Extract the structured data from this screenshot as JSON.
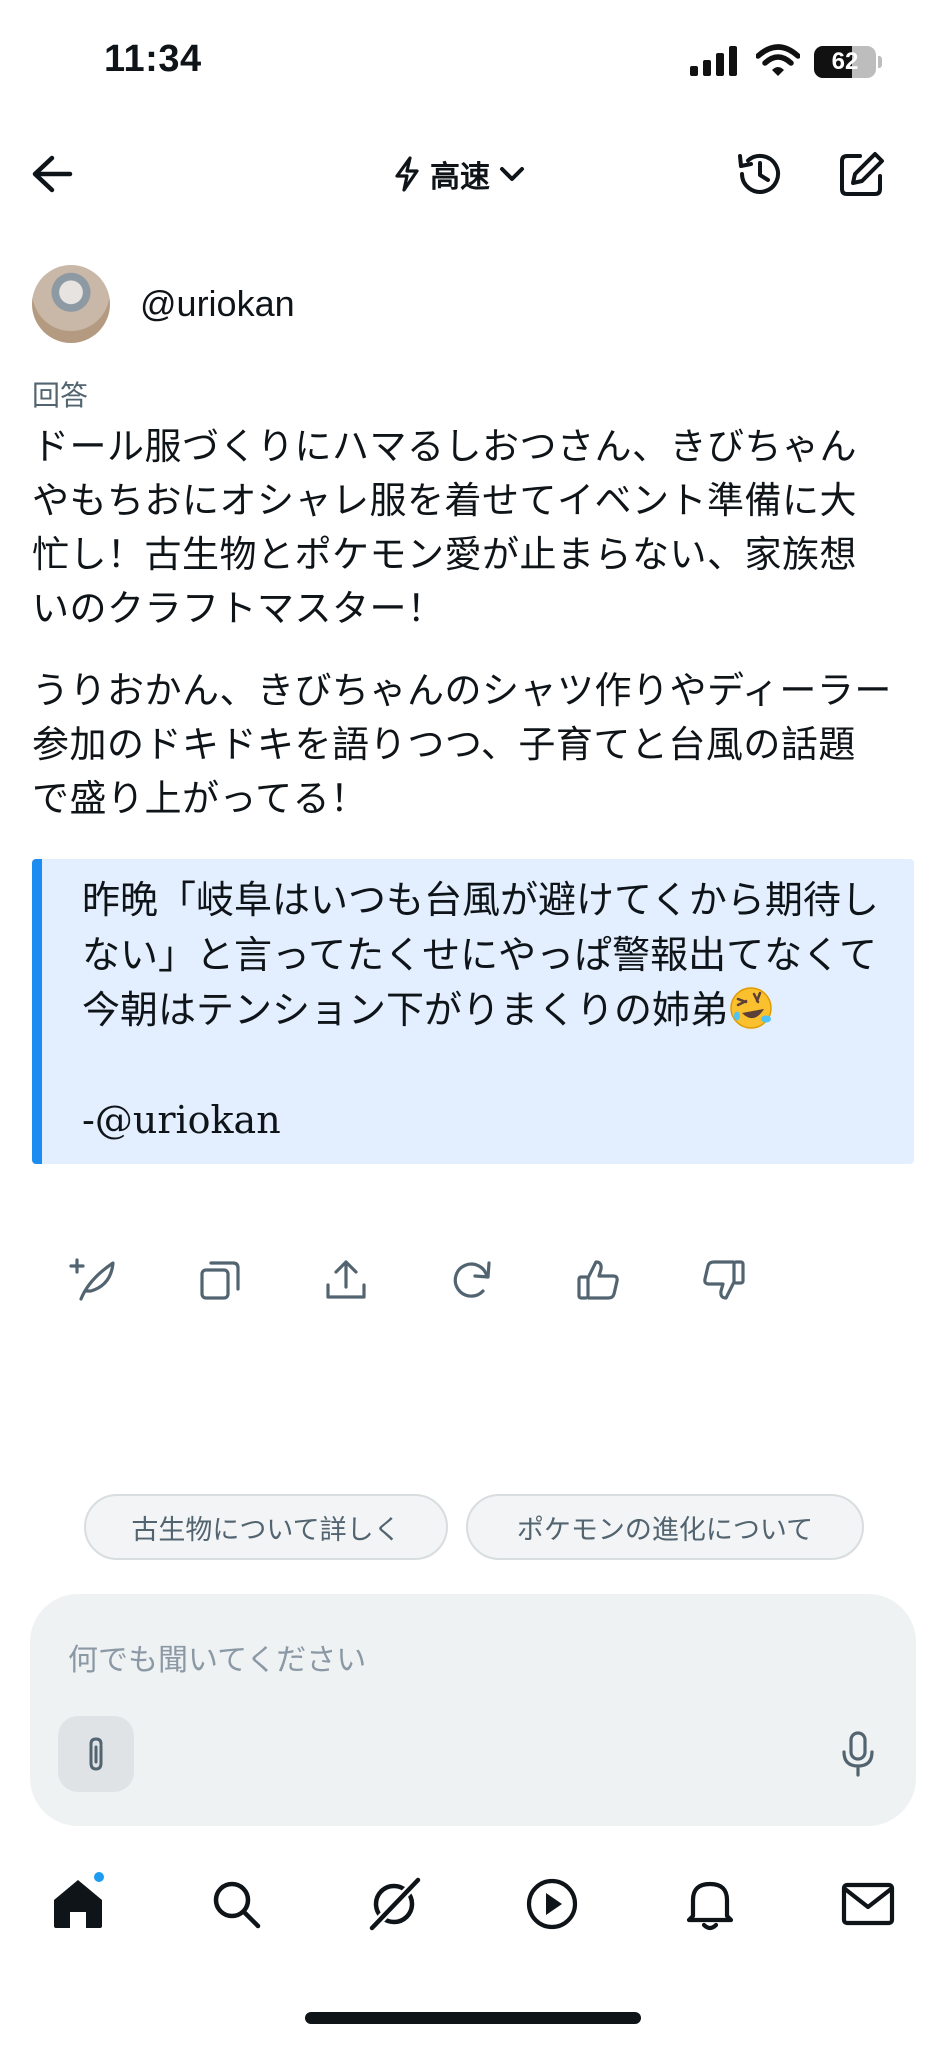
{
  "status_bar": {
    "time": "11:34",
    "battery_level": "62",
    "battery_fraction": 0.62,
    "icons": [
      "signal-icon",
      "wifi-icon",
      "battery-icon"
    ]
  },
  "header": {
    "mode_label": "高速",
    "icons": [
      "back-arrow-icon",
      "lightning-icon",
      "chevron-down-icon",
      "history-icon",
      "new-chat-icon"
    ]
  },
  "post": {
    "username": "@uriokan",
    "label": "回答",
    "paragraphs": [
      "ドール服づくりにハマるしおつさん、きびちゃんやもちおにオシャレ服を着せてイベント準備に大忙し！古生物とポケモン愛が止まらない、家族想いのクラフトマスター！",
      "うりおかん、きびちゃんのシャツ作りやディーラー参加のドキドキを語りつつ、子育てと台風の話題で盛り上がってる！"
    ],
    "quote": {
      "text": "昨晩「岐阜はいつも台風が避けてくから期待しない」と言ってたくせにやっぱ警報出てなくて今朝はテンション下がりまくりの姉弟",
      "emoji": "rolling-on-floor-laughing-emoji",
      "author": "-@uriokan"
    },
    "accent_color": "#1d8cf0",
    "quote_bg": "#e3efff"
  },
  "actions": [
    "compose-reply-icon",
    "copy-icon",
    "share-icon",
    "regenerate-icon",
    "thumbs-up-icon",
    "thumbs-down-icon"
  ],
  "suggestions": [
    "古生物について詳しく",
    "ポケモンの進化について"
  ],
  "composer": {
    "placeholder": "何でも聞いてください",
    "icons": [
      "paperclip-icon",
      "microphone-icon"
    ]
  },
  "tab_bar": {
    "tabs": [
      "home-icon",
      "search-icon",
      "grok-icon",
      "play-icon",
      "bell-icon",
      "mail-icon"
    ],
    "home_has_badge": true
  }
}
